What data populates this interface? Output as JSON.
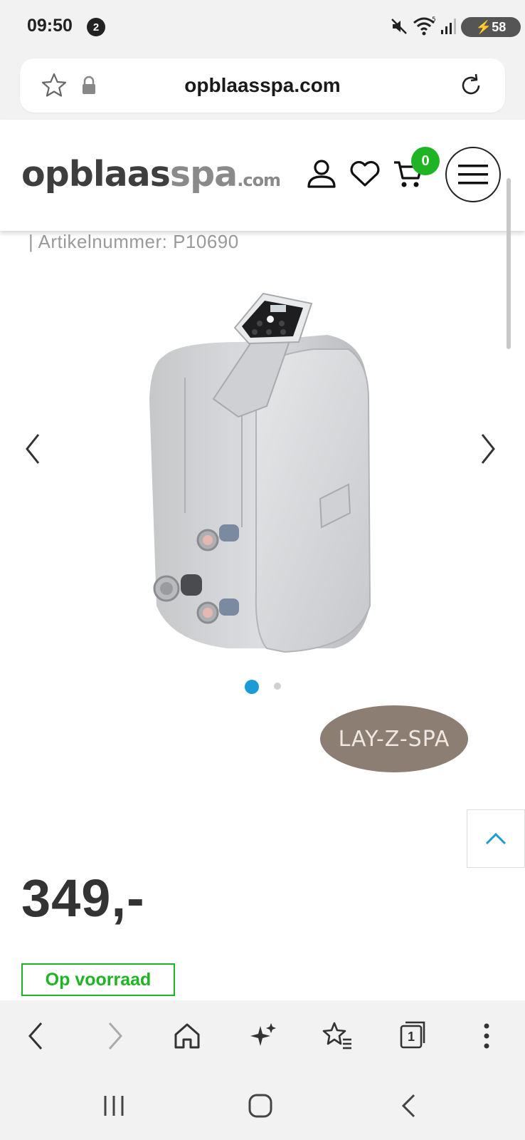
{
  "status_bar": {
    "time": "09:50",
    "notification_badge": "2",
    "battery": "58",
    "icons": [
      "mute-icon",
      "wifi-icon",
      "signal-icon",
      "battery-icon"
    ]
  },
  "url_bar": {
    "url": "opblaasspa.com",
    "icons": [
      "star-icon",
      "lock-icon",
      "reload-icon"
    ]
  },
  "site_header": {
    "logo_main": "opblaas",
    "logo_spa": "spa",
    "logo_tld": ".com",
    "cart_count": "0",
    "icons": [
      "account-icon",
      "wishlist-icon",
      "cart-icon",
      "menu-icon"
    ]
  },
  "product": {
    "article_number": "| Artikelnummer: P10690",
    "brand": "LAY-Z-SPA",
    "price": "349,-",
    "stock_status": "Op voorraad",
    "gallery_total": 2,
    "gallery_active": 1
  },
  "browser_toolbar": {
    "tab_count": "1",
    "icons": [
      "back-icon",
      "forward-icon",
      "home-icon",
      "sparkle-icon",
      "bookmarks-icon",
      "tabs-icon",
      "more-icon"
    ]
  },
  "nav_bar": {
    "icons": [
      "recents-icon",
      "home-nav-icon",
      "back-nav-icon"
    ]
  },
  "colors": {
    "accent_green": "#1eb423",
    "dot_active": "#1d9bd7",
    "brand_oval": "#8c7e73"
  }
}
